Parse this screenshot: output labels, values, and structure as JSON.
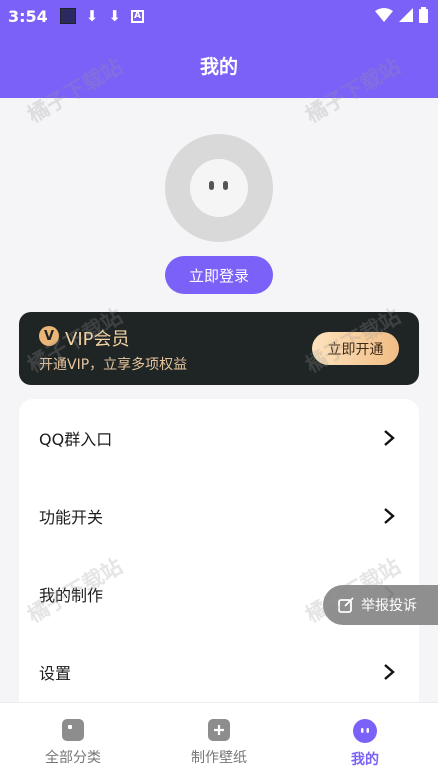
{
  "status_bar": {
    "time": "3:54",
    "left_icons": [
      "app-square-icon",
      "download-icon",
      "download-icon",
      "text-icon"
    ],
    "right_icons": [
      "wifi-icon",
      "signal-icon",
      "battery-icon"
    ],
    "text_icon_label": "A"
  },
  "header": {
    "title": "我的"
  },
  "profile": {
    "login_label": "立即登录"
  },
  "vip": {
    "badge": "V",
    "title": "VIP会员",
    "subtitle": "开通VIP，立享多项权益",
    "open_label": "立即开通"
  },
  "menu": {
    "items": [
      {
        "label": "QQ群入口"
      },
      {
        "label": "功能开关"
      },
      {
        "label": "我的制作"
      },
      {
        "label": "设置"
      }
    ]
  },
  "report": {
    "label": "举报投诉"
  },
  "tabs": [
    {
      "label": "全部分类",
      "active": false,
      "icon": "category-icon"
    },
    {
      "label": "制作壁纸",
      "active": false,
      "icon": "add-icon"
    },
    {
      "label": "我的",
      "active": true,
      "icon": "profile-icon"
    }
  ],
  "watermark": "橘子下载站",
  "colors": {
    "accent": "#7b61f8",
    "vip_bg": "#1f2424",
    "vip_gold": "#f4d3a5"
  }
}
